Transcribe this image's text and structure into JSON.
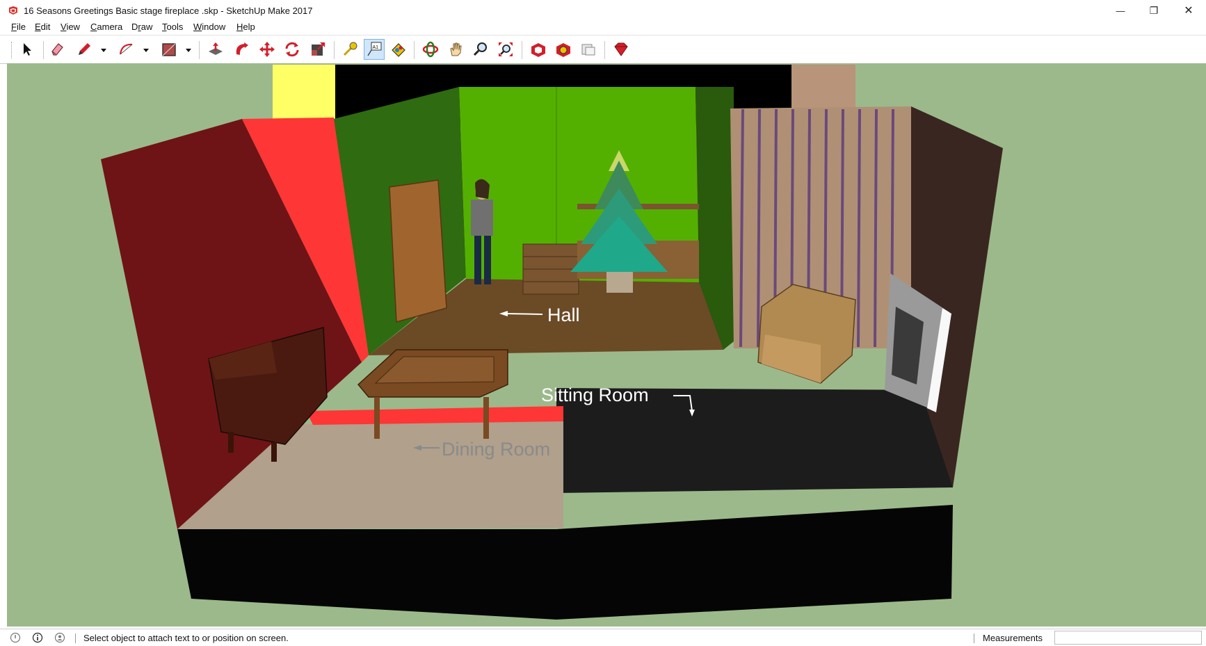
{
  "window": {
    "title": "16 Seasons Greetings Basic stage fireplace .skp - SketchUp Make 2017",
    "minimize_glyph": "—",
    "restore_glyph": "❐",
    "close_glyph": "✕"
  },
  "menu": {
    "items": [
      {
        "key": "F",
        "rest": "ile"
      },
      {
        "key": "E",
        "rest": "dit"
      },
      {
        "key": "V",
        "rest": "iew"
      },
      {
        "key": "C",
        "rest": "amera"
      },
      {
        "pre": "D",
        "key": "r",
        "rest": "aw"
      },
      {
        "key": "T",
        "rest": "ools"
      },
      {
        "key": "W",
        "rest": "indow"
      },
      {
        "key": "H",
        "rest": "elp"
      }
    ]
  },
  "toolbar": {
    "tools": [
      "select-icon",
      "eraser-icon",
      "pencil-icon",
      "arc-icon",
      "rectangle-icon",
      "push-pull-icon",
      "follow-me-icon",
      "move-icon",
      "rotate-icon",
      "scale-icon",
      "tape-measure-icon",
      "text-icon",
      "paint-bucket-icon",
      "orbit-icon",
      "pan-icon",
      "zoom-icon",
      "zoom-extents-icon",
      "warehouse-icon",
      "extension-warehouse-icon",
      "layout-icon",
      "ruby-icon"
    ],
    "active_tool": "text-icon",
    "text_tool_glyph": "A1"
  },
  "scene": {
    "labels": {
      "hall": "Hall",
      "sitting_room": "Sitting Room",
      "dining_room": "Dining Room"
    },
    "colors": {
      "background": "#9cb98b",
      "red_wall": "#ff3636",
      "dark_red_wall": "#6e1416",
      "green_wall": "#2f6b10",
      "lime_wall": "#54b000",
      "floor_dark": "#1a1a1a",
      "floor_dining": "#b0a08c"
    }
  },
  "status": {
    "message": "Select object to attach text to or position on screen.",
    "measurements_label": "Measurements",
    "measurements_value": ""
  }
}
